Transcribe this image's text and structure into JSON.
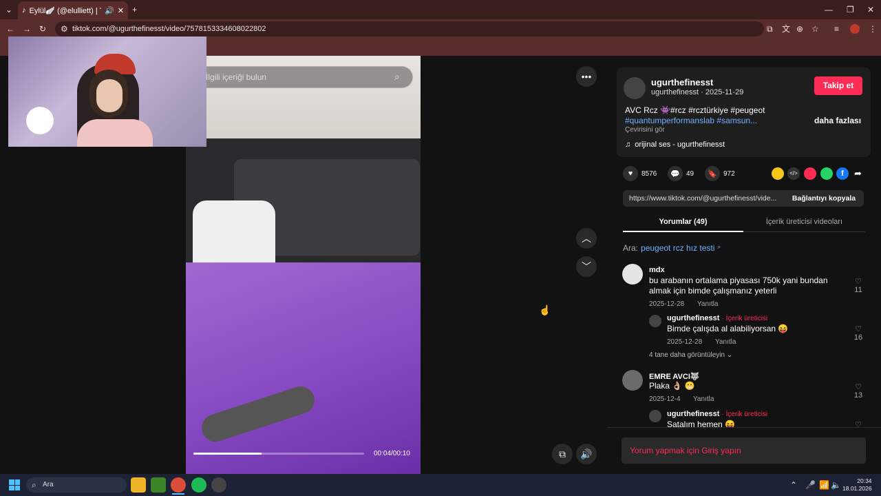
{
  "browser": {
    "tab_title": "Eylül🪽 (@elulliett) | TikTok",
    "url": "tiktok.com/@ugurthefinesst/video/7578153334608022802"
  },
  "search": {
    "placeholder": "İlgili içeriği bulun"
  },
  "video": {
    "time": "00:04/00:10",
    "progress": 0.4
  },
  "creator": {
    "username": "ugurthefinesst",
    "handle_date": "ugurthefinesst · 2025-11-29",
    "follow_label": "Takip et",
    "caption_line1": "AVC Rcz 👾#rcz #rcztürkiye #peugeot",
    "caption_line2": "#quantumperformanslab #samsun...",
    "more_label": "daha fazlası",
    "translate_label": "Çevirisini gör",
    "sound": "orijinal ses - ugurthefinesst"
  },
  "stats": {
    "likes": "8576",
    "comments": "49",
    "saves": "972"
  },
  "share": {
    "link": "https://www.tiktok.com/@ugurthefinesst/vide...",
    "copy_label": "Bağlantıyı kopyala"
  },
  "tabs": {
    "comments": "Yorumlar (49)",
    "creator_videos": "İçerik üreticisi videoları"
  },
  "related_search": {
    "prefix": "Ara:",
    "query": "peugeot rcz hız testi"
  },
  "comments": [
    {
      "name": "mdx",
      "text1": "bu arabanın ortalama piyasası 750k yani bundan",
      "text2": "almak için bimde çalışmanız yeterli",
      "date": "2025-12-28",
      "reply": "Yanıtla",
      "likes": "11"
    },
    {
      "name": "ugurthefinesst",
      "badge": "· İçerik üreticisi",
      "text1": "Bimde çalışda al alabiliyorsan 😝",
      "date": "2025-12-28",
      "reply": "Yanıtla",
      "likes": "16"
    },
    {
      "name": "EMRE AVCI🐺",
      "text1": "Plaka 👌🏼 😬",
      "date": "2025-12-4",
      "reply": "Yanıtla",
      "likes": "13"
    },
    {
      "name": "ugurthefinesst",
      "badge": "· İçerik üreticisi",
      "text1": "Satalım hemen 😝"
    }
  ],
  "more_replies": "4 tane daha görüntüleyin",
  "comment_prompt": "Yorum yapmak için Giriş yapın",
  "taskbar": {
    "search": "Ara",
    "time": "20:34",
    "date": "18.01.2026"
  },
  "colors": {
    "accent": "#fe2c55",
    "link": "#6fb3ff"
  }
}
